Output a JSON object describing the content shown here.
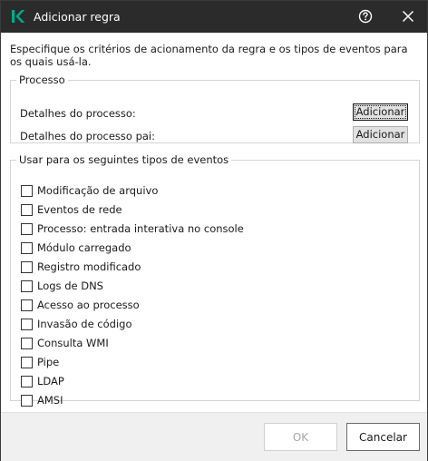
{
  "window": {
    "title": "Adicionar regra",
    "accent_color": "#00a88e"
  },
  "description": "Especifique os critérios de acionamento da regra e os tipos de eventos para os quais usá-la.",
  "process_group": {
    "legend": "Processo",
    "rows": [
      {
        "label": "Detalhes do processo:",
        "button": "Adicionar"
      },
      {
        "label": "Detalhes do processo pai:",
        "button": "Adicionar"
      }
    ]
  },
  "events_group": {
    "legend": "Usar para os seguintes tipos de eventos",
    "items": [
      {
        "label": "Modificação de arquivo",
        "checked": false
      },
      {
        "label": "Eventos de rede",
        "checked": false
      },
      {
        "label": "Processo: entrada interativa no console",
        "checked": false
      },
      {
        "label": "Módulo carregado",
        "checked": false
      },
      {
        "label": "Registro modificado",
        "checked": false
      },
      {
        "label": "Logs de DNS",
        "checked": false
      },
      {
        "label": "Acesso ao processo",
        "checked": false
      },
      {
        "label": "Invasão de código",
        "checked": false
      },
      {
        "label": "Consulta WMI",
        "checked": false
      },
      {
        "label": "Pipe",
        "checked": false
      },
      {
        "label": "LDAP",
        "checked": false
      },
      {
        "label": "AMSI",
        "checked": false
      }
    ]
  },
  "footer": {
    "ok_label": "OK",
    "cancel_label": "Cancelar"
  }
}
